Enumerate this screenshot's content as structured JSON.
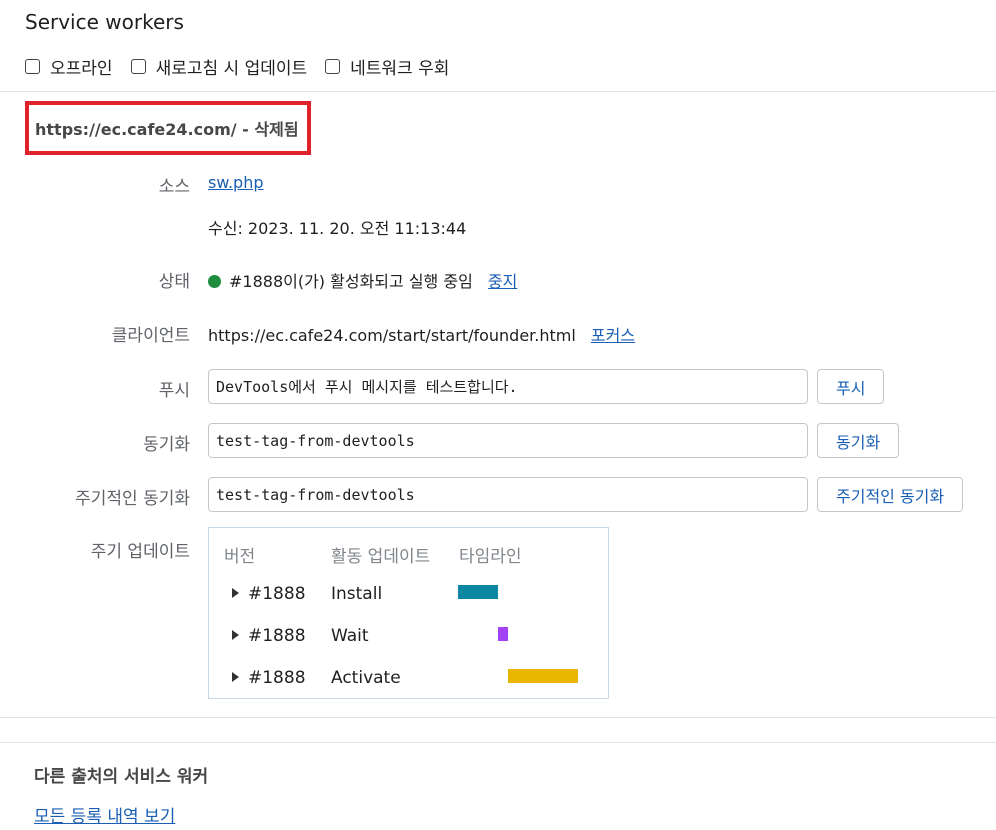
{
  "header": {
    "title": "Service workers"
  },
  "options": [
    {
      "label": "오프라인",
      "checked": false
    },
    {
      "label": "새로고침 시 업데이트",
      "checked": false
    },
    {
      "label": "네트워크 우회",
      "checked": false
    }
  ],
  "worker": {
    "origin_title": "https://ec.cafe24.com/ - 삭제됨",
    "highlight_color": "#e2222a",
    "source": {
      "label": "소스",
      "link": "sw.php",
      "received": "수신: 2023. 11. 20. 오전 11:13:44"
    },
    "status": {
      "label": "상태",
      "text": "#1888이(가) 활성화되고 실행 중임",
      "action": "중지",
      "dot_color": "#1e8e3e"
    },
    "clients": {
      "label": "클라이언트",
      "url": "https://ec.cafe24.com/start/start/founder.html",
      "action": "포커스"
    },
    "push": {
      "label": "푸시",
      "value": "DevTools에서 푸시 메시지를 테스트합니다.",
      "button": "푸시"
    },
    "sync": {
      "label": "동기화",
      "value": "test-tag-from-devtools",
      "button": "동기화"
    },
    "periodic_sync": {
      "label": "주기적인 동기화",
      "value": "test-tag-from-devtools",
      "button": "주기적인 동기화"
    },
    "update_cycle": {
      "label": "주기 업데이트",
      "headers": {
        "version": "버전",
        "activity": "활동 업데이트",
        "timeline": "타임라인"
      },
      "rows": [
        {
          "version": "#1888",
          "activity": "Install",
          "color": "#0b87a1"
        },
        {
          "version": "#1888",
          "activity": "Wait",
          "color": "#a142f4"
        },
        {
          "version": "#1888",
          "activity": "Activate",
          "color": "#e8b600"
        }
      ]
    }
  },
  "other_origins": {
    "title": "다른 출처의 서비스 워커",
    "link": "모든 등록 내역 보기"
  }
}
